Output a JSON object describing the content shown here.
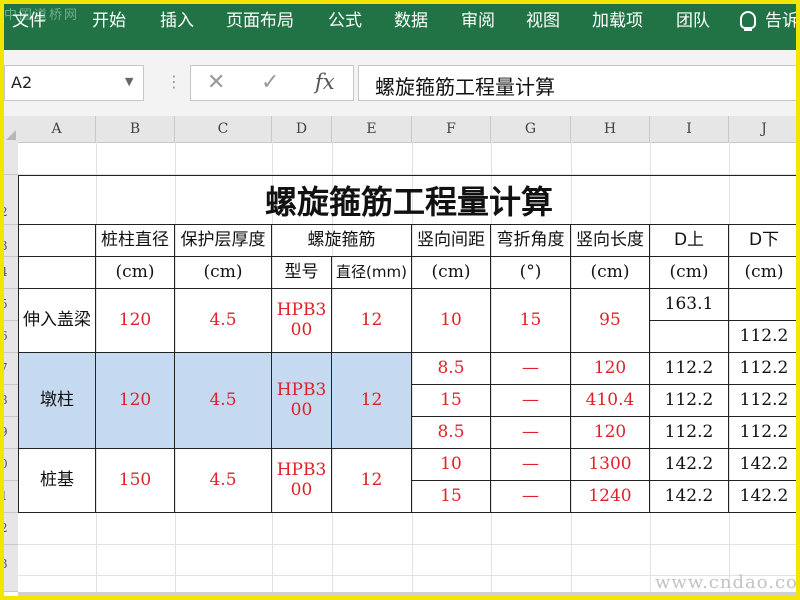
{
  "ribbon": {
    "watermark": "中国道桥网",
    "menu": [
      "文件",
      "开始",
      "插入",
      "页面布局",
      "公式",
      "数据",
      "审阅",
      "视图",
      "加载项",
      "团队",
      "告诉"
    ]
  },
  "formula_bar": {
    "name_box": "A2",
    "name_caret": "▼",
    "dots": "⋮",
    "cancel_icon": "✕",
    "confirm_icon": "✓",
    "fx_label": "fx",
    "content": "螺旋箍筋工程量计算"
  },
  "columns": [
    "A",
    "B",
    "C",
    "D",
    "E",
    "F",
    "G",
    "H",
    "I",
    "J"
  ],
  "rows": [
    "1",
    "2",
    "3",
    "4",
    "5",
    "6",
    "7",
    "8",
    "9",
    "0",
    "1",
    "2",
    "3"
  ],
  "sheet": {
    "title": "螺旋箍筋工程量计算",
    "headers": {
      "b": "桩柱直径",
      "c": "保护层厚度",
      "de": "螺旋箍筋",
      "f": "竖向间距",
      "g": "弯折角度",
      "h": "竖向长度",
      "i": "D上",
      "j": "D下"
    },
    "units": {
      "b": "(cm)",
      "c": "(cm)",
      "d": "型号",
      "e": "直径(mm)",
      "f": "(cm)",
      "g": "(°)",
      "h": "(cm)",
      "i": "(cm)",
      "j": "(cm)"
    },
    "groups": [
      {
        "name": "伸入盖梁",
        "diameter": "120",
        "cover": "4.5",
        "type": "HPB300",
        "dia_mm": "12",
        "rows": [
          {
            "f": "10",
            "g": "15",
            "h": "95",
            "i": "163.1",
            "j": ""
          },
          {
            "f": "",
            "g": "",
            "h": "",
            "i": "",
            "j": "112.2"
          }
        ]
      },
      {
        "name": "墩柱",
        "diameter": "120",
        "cover": "4.5",
        "type": "HPB300",
        "dia_mm": "12",
        "rows": [
          {
            "f": "8.5",
            "g": "—",
            "h": "120",
            "i": "112.2",
            "j": "112.2"
          },
          {
            "f": "15",
            "g": "—",
            "h": "410.4",
            "i": "112.2",
            "j": "112.2"
          },
          {
            "f": "8.5",
            "g": "—",
            "h": "120",
            "i": "112.2",
            "j": "112.2"
          }
        ]
      },
      {
        "name": "桩基",
        "diameter": "150",
        "cover": "4.5",
        "type": "HPB300",
        "dia_mm": "12",
        "rows": [
          {
            "f": "10",
            "g": "—",
            "h": "1300",
            "i": "142.2",
            "j": "142.2"
          },
          {
            "f": "15",
            "g": "—",
            "h": "1240",
            "i": "142.2",
            "j": "142.2"
          }
        ]
      }
    ]
  },
  "watermark_bottom": "www.cndao.com",
  "colors": {
    "ribbon": "#217346",
    "highlight_fill": "#c5d9f1",
    "value_red": "#e0202a",
    "frame": "#f2e600"
  }
}
